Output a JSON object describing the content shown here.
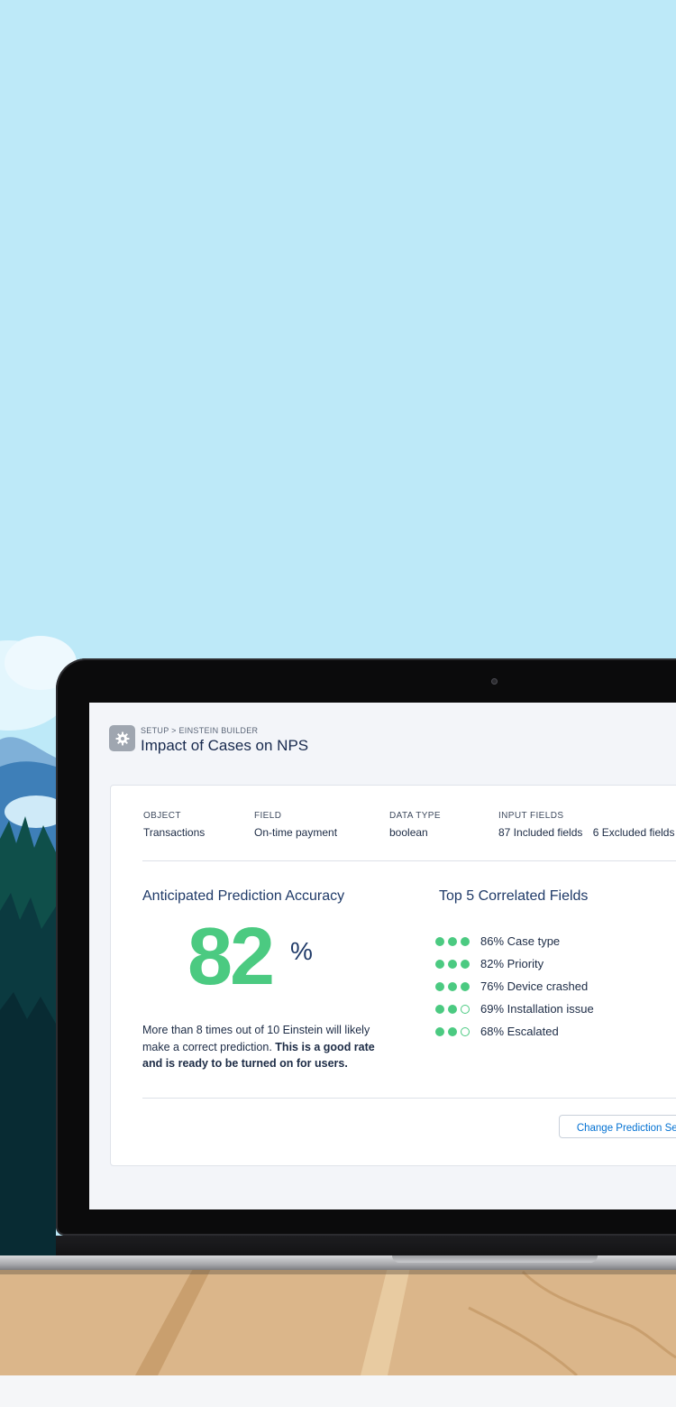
{
  "header": {
    "breadcrumb": "SETUP > EINSTEIN BUILDER",
    "title": "Impact of Cases on NPS",
    "icon": "gear-icon"
  },
  "meta": [
    {
      "label": "OBJECT",
      "value": "Transactions"
    },
    {
      "label": "FIELD",
      "value": "On-time payment"
    },
    {
      "label": "DATA TYPE",
      "value": "boolean"
    },
    {
      "label": "INPUT FIELDS",
      "value": "87 Included fields",
      "value2": "6 Excluded fields"
    }
  ],
  "accuracy": {
    "heading": "Anticipated Prediction Accuracy",
    "value": "82",
    "unit": "%",
    "description_plain": "More than 8 times out of 10 Einstein will likely make a correct prediction.",
    "description_bold": "This is a good rate and is ready to be turned on for users."
  },
  "correlated": {
    "heading": "Top 5 Correlated Fields",
    "items": [
      {
        "label": "86% Case type",
        "strength": 3
      },
      {
        "label": "82% Priority",
        "strength": 3
      },
      {
        "label": "76% Device crashed",
        "strength": 3
      },
      {
        "label": "69% Installation issue",
        "strength": 2
      },
      {
        "label": "68% Escalated",
        "strength": 2
      }
    ]
  },
  "actions": {
    "change_label": "Change Prediction Settings"
  },
  "colors": {
    "accent_green": "#4bca81",
    "title_navy": "#1f3a68",
    "sky": "#bde9f8",
    "link_blue": "#0070d2"
  }
}
